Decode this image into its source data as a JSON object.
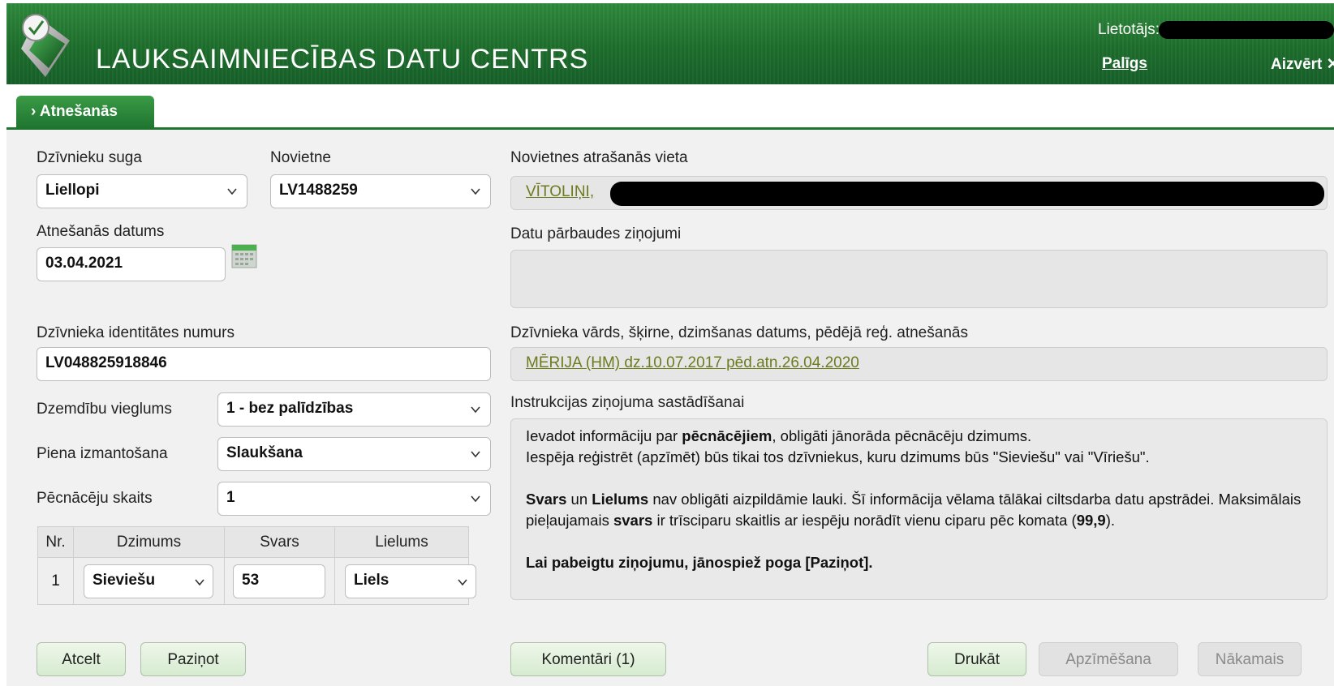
{
  "header": {
    "title": "LAUKSAIMNIECĪBAS DATU CENTRS",
    "user_label": "Lietotājs:",
    "help_link": "Palīgs",
    "close_link": "Aizvērt",
    "close_icon": "✕"
  },
  "tab": {
    "label": "› Atnešanās"
  },
  "form": {
    "species_label": "Dzīvnieku suga",
    "species_value": "Liellopi",
    "holding_label": "Novietne",
    "holding_value": "LV1488259",
    "location_label": "Novietnes atrašanās vieta",
    "location_value": "VĪTOLIŅI,",
    "date_label": "Atnešanās datums",
    "date_value": "03.04.2021",
    "check_label": "Datu pārbaudes ziņojumi",
    "id_label": "Dzīvnieka identitātes numurs",
    "id_value": "LV048825918846",
    "animal_info_label": "Dzīvnieka vārds, šķirne, dzimšanas datums, pēdējā reģ. atnešanās",
    "animal_info_value": "MĒRIJA (HM) dz.10.07.2017 pēd.atn.26.04.2020",
    "ease_label": "Dzemdību vieglums",
    "ease_value": "1 - bez palīdzības",
    "milk_label": "Piena izmantošana",
    "milk_value": "Slaukšana",
    "count_label": "Pēcnācēju skaits",
    "count_value": "1"
  },
  "offspring_table": {
    "headers": [
      "Nr.",
      "Dzimums",
      "Svars",
      "Lielums"
    ],
    "rows": [
      {
        "nr": "1",
        "sex": "Sieviešu",
        "weight": "53",
        "size": "Liels"
      }
    ]
  },
  "instructions": {
    "label": "Instrukcijas ziņojuma sastādīšanai",
    "p1_a": "Ievadot informāciju par ",
    "p1_b": "pēcnācējiem",
    "p1_c": ", obligāti jānorāda pēcnācēju dzimums.",
    "p2": "Iespēja reģistrēt (apzīmēt) būs tikai tos dzīvniekus, kuru dzimums būs \"Sieviešu\" vai \"Vīriešu\".",
    "p3_a": "Svars",
    "p3_b": " un ",
    "p3_c": "Lielums",
    "p3_d": " nav obligāti aizpildāmie lauki. Šī informācija vēlama tālākai ciltsdarba datu apstrādei. Maksimālais pieļaujamais ",
    "p3_e": "svars",
    "p3_f": " ir trīsciparu skaitlis ar iespēju norādīt vienu ciparu pēc komata (",
    "p3_g": "99,9",
    "p3_h": ").",
    "p4": "Lai pabeigtu ziņojumu, jānospiež poga [Paziņot]."
  },
  "buttons": {
    "cancel": "Atcelt",
    "submit": "Paziņot",
    "comments": "Komentāri (1)",
    "print": "Drukāt",
    "mark": "Apzīmēšana",
    "next": "Nākamais"
  },
  "colors": {
    "header_green": "#1e6e2c",
    "button_bg": "#d6ebd0",
    "link_olive": "#6e7a1e"
  }
}
